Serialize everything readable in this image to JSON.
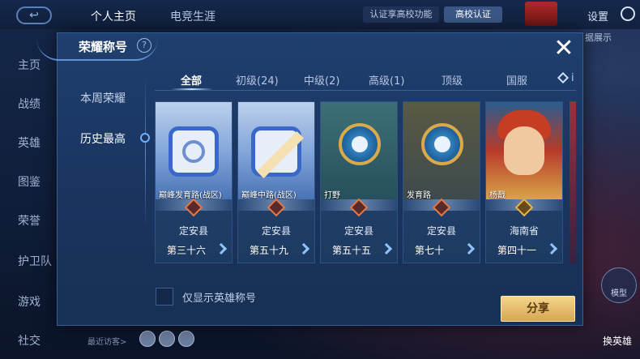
{
  "background": {
    "top_tabs": [
      "个人主页",
      "电竞生涯"
    ],
    "verify_text": "认证享高校功能",
    "verify_button": "高校认证",
    "settings_label": "设置",
    "side_nav": [
      "主页",
      "战绩",
      "英雄",
      "图鉴",
      "荣誉",
      "护卫队",
      "游戏",
      "社交"
    ],
    "right_side_label": "据展示",
    "model_button": "模型",
    "swap_hero": "换英雄",
    "recent_visitors": "最近访客>"
  },
  "modal": {
    "title": "荣耀称号",
    "help": "?",
    "close": "✕",
    "left_menu": [
      {
        "label": "本周荣耀",
        "active": false
      },
      {
        "label": "历史最高",
        "active": true
      }
    ],
    "tabs": [
      {
        "label": "全部",
        "active": true
      },
      {
        "label": "初级(24)",
        "active": false
      },
      {
        "label": "中级(2)",
        "active": false
      },
      {
        "label": "高级(1)",
        "active": false
      },
      {
        "label": "顶级",
        "active": false
      },
      {
        "label": "国服",
        "active": false
      },
      {
        "label": "i",
        "active": false
      }
    ],
    "cards": [
      {
        "label": "巅峰发育路(战区)",
        "region": "定安县",
        "rank": "第三十六",
        "art": "square-emblem"
      },
      {
        "label": "巅峰中路(战区)",
        "region": "定安县",
        "rank": "第五十九",
        "art": "square-emblem-slash"
      },
      {
        "label": "打野",
        "region": "定安县",
        "rank": "第五十五",
        "art": "round-emblem"
      },
      {
        "label": "发育路",
        "region": "定安县",
        "rank": "第七十",
        "art": "round-emblem"
      },
      {
        "label": "杨戬",
        "region": "海南省",
        "rank": "第四十一",
        "art": "hero"
      }
    ],
    "checkbox_label": "仅显示英雄称号",
    "share_button": "分享"
  },
  "colors": {
    "accent": "#8fc2ff",
    "share_button": "#e8bf6f",
    "panel": "#1f3f6e"
  }
}
